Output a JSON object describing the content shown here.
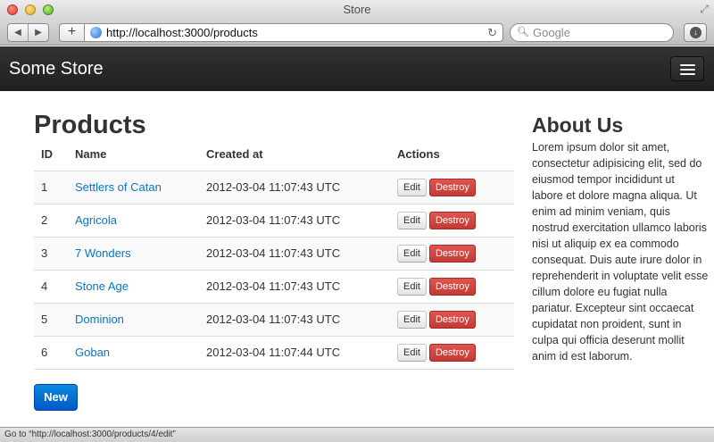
{
  "window": {
    "title": "Store"
  },
  "toolbar": {
    "back_icon": "back-arrow-icon",
    "forward_icon": "forward-arrow-icon",
    "url": "http://localhost:3000/products",
    "search_placeholder": "Google"
  },
  "navbar": {
    "brand": "Some Store",
    "menu_icon": "hamburger-menu-icon",
    "bg_color": "#222222"
  },
  "page": {
    "title": "Products",
    "columns": [
      "ID",
      "Name",
      "Created at",
      "Actions"
    ],
    "rows": [
      {
        "id": "1",
        "name": "Settlers of Catan",
        "created_at": "2012-03-04 11:07:43 UTC",
        "edit": "Edit",
        "destroy": "Destroy"
      },
      {
        "id": "2",
        "name": "Agricola",
        "created_at": "2012-03-04 11:07:43 UTC",
        "edit": "Edit",
        "destroy": "Destroy"
      },
      {
        "id": "3",
        "name": "7 Wonders",
        "created_at": "2012-03-04 11:07:43 UTC",
        "edit": "Edit",
        "destroy": "Destroy"
      },
      {
        "id": "4",
        "name": "Stone Age",
        "created_at": "2012-03-04 11:07:43 UTC",
        "edit": "Edit",
        "destroy": "Destroy"
      },
      {
        "id": "5",
        "name": "Dominion",
        "created_at": "2012-03-04 11:07:43 UTC",
        "edit": "Edit",
        "destroy": "Destroy"
      },
      {
        "id": "6",
        "name": "Goban",
        "created_at": "2012-03-04 11:07:44 UTC",
        "edit": "Edit",
        "destroy": "Destroy"
      }
    ],
    "new_button": "New",
    "link_color": "#0a75c2",
    "destroy_color": "#d9534f",
    "new_button_color": "#0062cc"
  },
  "sidebar": {
    "title": "About Us",
    "text": "Lorem ipsum dolor sit amet, consectetur adipisicing elit, sed do eiusmod tempor incididunt ut labore et dolore magna aliqua. Ut enim ad minim veniam, quis nostrud exercitation ullamco laboris nisi ut aliquip ex ea commodo consequat. Duis aute irure dolor in reprehenderit in voluptate velit esse cillum dolore eu fugiat nulla pariatur. Excepteur sint occaecat cupidatat non proident, sunt in culpa qui officia deserunt mollit anim id est laborum."
  },
  "statusbar": {
    "text": "Go to “http://localhost:3000/products/4/edit”"
  }
}
